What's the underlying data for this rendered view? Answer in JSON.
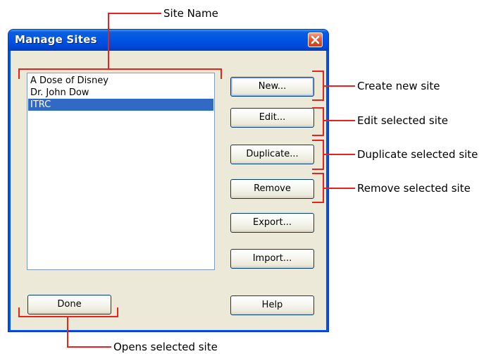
{
  "dialog": {
    "title": "Manage Sites",
    "close_glyph": "close-icon"
  },
  "site_list": {
    "items": [
      {
        "label": "A Dose of Disney",
        "selected": false
      },
      {
        "label": "Dr. John Dow",
        "selected": false
      },
      {
        "label": "ITRC",
        "selected": true
      }
    ]
  },
  "buttons": {
    "new": "New...",
    "edit": "Edit...",
    "duplicate": "Duplicate...",
    "remove": "Remove",
    "export": "Export...",
    "import": "Import...",
    "done": "Done",
    "help": "Help"
  },
  "annotations": {
    "site_name": "Site Name",
    "create_new": "Create new site",
    "edit_selected": "Edit selected site",
    "duplicate_selected": "Duplicate selected site",
    "remove_selected": "Remove selected site",
    "opens_selected": "Opens selected site"
  },
  "colors": {
    "annotation_red": "#e8231c",
    "title_blue": "#0055e5",
    "dialog_face": "#ece9d8",
    "selection": "#316ac5"
  }
}
